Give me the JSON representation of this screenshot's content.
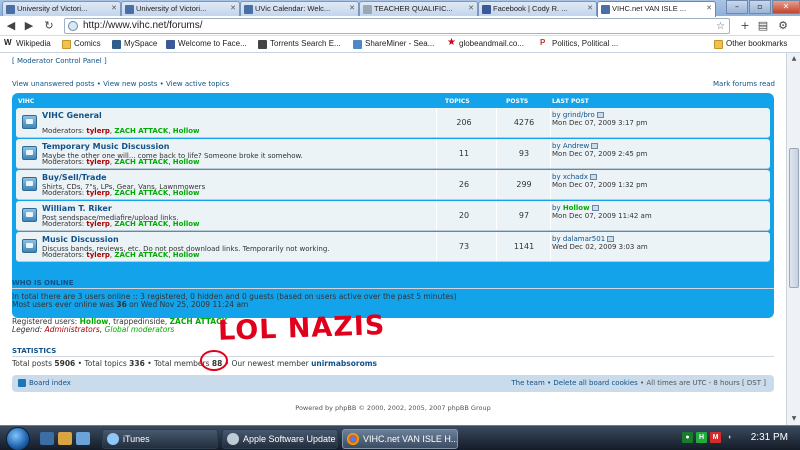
{
  "browser": {
    "tabs": [
      {
        "title": "University of Victori...",
        "color": "#4a6fa5"
      },
      {
        "title": "University of Victori...",
        "color": "#4a6fa5"
      },
      {
        "title": "UVic Calendar: Welc...",
        "color": "#4a6fa5"
      },
      {
        "title": "TEACHER QUALIFIC...",
        "color": "#9aa7b5"
      },
      {
        "title": "Facebook | Cody R. ...",
        "color": "#3b5998"
      },
      {
        "title": "VIHC.net VAN ISLE ...",
        "color": "#4a6fa5",
        "active": true
      }
    ],
    "url": "http://www.vihc.net/forums/",
    "bookmarks": [
      {
        "label": "Wikipedia",
        "icon": "wikipedia-icon"
      },
      {
        "label": "Comics",
        "icon": "folder-icon"
      },
      {
        "label": "MySpace",
        "icon": "myspace-icon"
      },
      {
        "label": "Welcome to Face...",
        "icon": "facebook-icon"
      },
      {
        "label": "Torrents Search E...",
        "icon": "torrent-icon"
      },
      {
        "label": "ShareMiner - Sea...",
        "icon": "globe-icon"
      },
      {
        "label": "globeandmail.co...",
        "icon": "star-icon"
      },
      {
        "label": "Politics, Political ...",
        "icon": "p-icon"
      },
      {
        "label": "Other bookmarks",
        "icon": "folder-icon"
      }
    ]
  },
  "forum": {
    "mcp_link": "[ Moderator Control Panel ]",
    "view_links": "View unanswered posts • View new posts • View active topics",
    "mark_read": "Mark forums read",
    "header": {
      "section": "VIHC",
      "topics": "TOPICS",
      "posts": "POSTS",
      "last_post": "LAST POST"
    },
    "moderators_label": "Moderators:",
    "rows": [
      {
        "name": "VIHC General",
        "desc": "",
        "topics": "206",
        "posts": "4276",
        "by_user": "grind/bro",
        "date": "Mon Dec 07, 2009 3:17 pm"
      },
      {
        "name": "Temporary Music Discussion",
        "desc": "Maybe the other one will... come back to life? Someone broke it somehow.",
        "topics": "11",
        "posts": "93",
        "by_user": "Andrew",
        "date": "Mon Dec 07, 2009 2:45 pm"
      },
      {
        "name": "Buy/Sell/Trade",
        "desc": "Shirts, CDs, 7\"s, LPs, Gear, Vans, Lawnmowers",
        "topics": "26",
        "posts": "299",
        "by_user": "xchadx",
        "date": "Mon Dec 07, 2009 1:32 pm"
      },
      {
        "name": "William T. Riker",
        "desc": "Post sendspace/mediafire/upload links.",
        "topics": "20",
        "posts": "97",
        "by_user": "Hollow",
        "date": "Mon Dec 07, 2009 11:42 am"
      },
      {
        "name": "Music Discussion",
        "desc": "Discuss bands, reviews, etc. Do not post download links. Temporarily not working.",
        "topics": "73",
        "posts": "1141",
        "by_user": "dalamar501",
        "date": "Wed Dec 02, 2009 3:03 am"
      }
    ],
    "moderators": [
      "tylerp",
      "ZACH ATTACK",
      "Hollow"
    ],
    "by_label": "by"
  },
  "who_is_online": {
    "heading": "WHO IS ONLINE",
    "line1": "In total there are 3 users online :: 3 registered, 0 hidden and 0 guests (based on users active over the past 5 minutes)",
    "line2_pre": "Most users ever online was ",
    "line2_num": "36",
    "line2_post": " on Wed Nov 25, 2009 11:24 am",
    "registered_label": "Registered users: ",
    "registered_users": [
      "Hollow",
      "trappedinside",
      "ZACH ATTACK"
    ],
    "legend_label": "Legend: ",
    "legend_admin": "Administrators",
    "legend_global": "Global moderators"
  },
  "statistics": {
    "heading": "STATISTICS",
    "total_posts_label": "Total posts ",
    "total_posts": "5906",
    "total_topics_label": " • Total topics ",
    "total_topics": "336",
    "total_members_label": " • Total members ",
    "total_members": "88",
    "newest_label": " • Our newest member ",
    "newest_member": "unirmabsoroms"
  },
  "annotation": {
    "text": "LOL NAZIS",
    "color": "#e0001b"
  },
  "footer": {
    "board_index": "Board index",
    "right_links": "The team • Delete all board cookies",
    "timezone": " • All times are UTC - 8 hours [ DST ]",
    "powered": "Powered by phpBB © 2000, 2002, 2005, 2007 phpBB Group"
  },
  "taskbar": {
    "items": [
      {
        "label": "iTunes",
        "icon": "itunes-icon"
      },
      {
        "label": "Apple Software Update",
        "icon": "apple-update-icon"
      },
      {
        "label": "VIHC.net VAN ISLE H...",
        "icon": "chrome-icon",
        "active": true
      }
    ],
    "clock": "2:31 PM"
  }
}
